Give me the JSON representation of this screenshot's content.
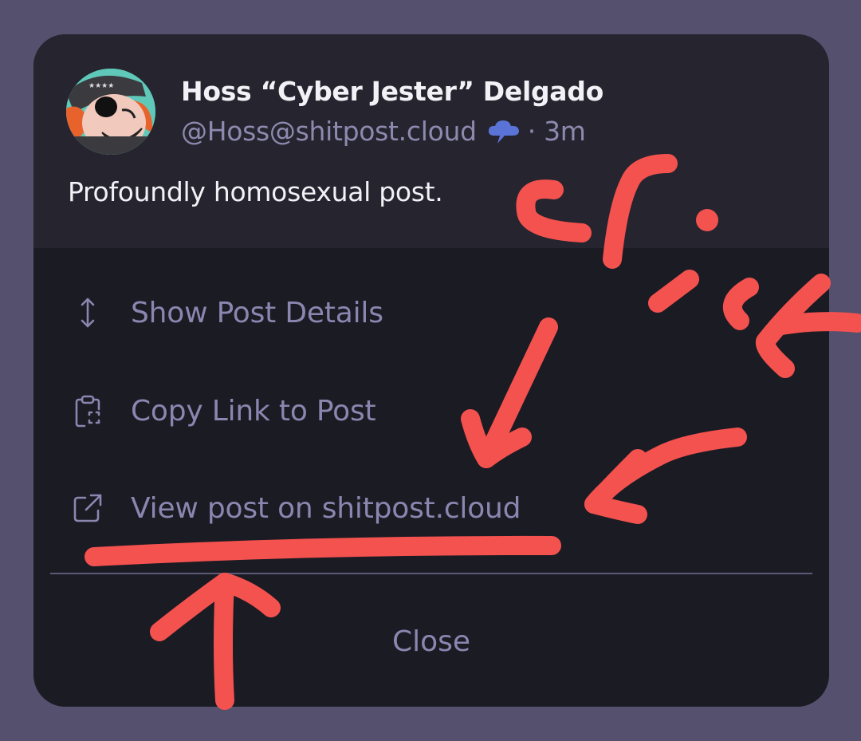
{
  "post": {
    "display_name": "Hoss “Cyber Jester” Delgado",
    "handle": "@Hoss@shitpost.cloud",
    "separator_time": "· 3m",
    "content": "Profoundly homosexual post.",
    "avatar_icon": "cartoon-face-avatar",
    "instance_icon": "cloud-icon"
  },
  "menu": {
    "items": [
      {
        "label": "Show Post Details",
        "icon": "expand-vertical-icon"
      },
      {
        "label": "Copy Link to Post",
        "icon": "clipboard-icon"
      },
      {
        "label": "View post on shitpost.cloud",
        "icon": "external-link-icon"
      }
    ],
    "close_label": "Close"
  },
  "annotation": {
    "text": "click",
    "color": "#f4524f"
  },
  "colors": {
    "backdrop": "#54506e",
    "header_bg": "#25242f",
    "menu_bg": "#1b1b23",
    "muted_text": "#8a86b0",
    "primary_text": "#f2f1f6"
  }
}
